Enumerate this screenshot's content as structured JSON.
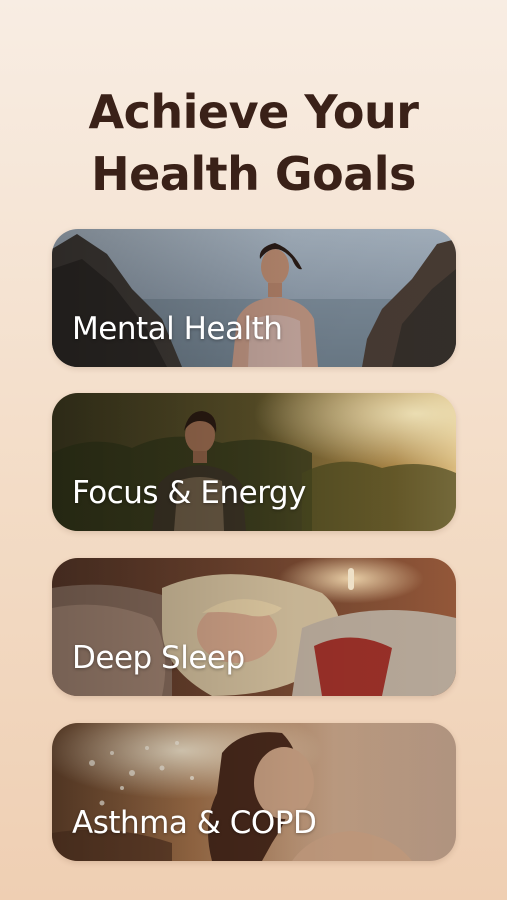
{
  "header": {
    "title_line1": "Achieve Your",
    "title_line2": "Health Goals"
  },
  "goals": [
    {
      "label": "Mental Health",
      "image": "woman-meditating-by-sea"
    },
    {
      "label": "Focus & Energy",
      "image": "man-in-sunlit-forest"
    },
    {
      "label": "Deep Sleep",
      "image": "woman-sleeping-in-bed"
    },
    {
      "label": "Asthma & COPD",
      "image": "woman-breathing-dandelions"
    }
  ],
  "colors": {
    "title": "#3a2118",
    "background_top": "#f8ede3",
    "background_bottom": "#efcfb3",
    "card_label": "#ffffff"
  }
}
